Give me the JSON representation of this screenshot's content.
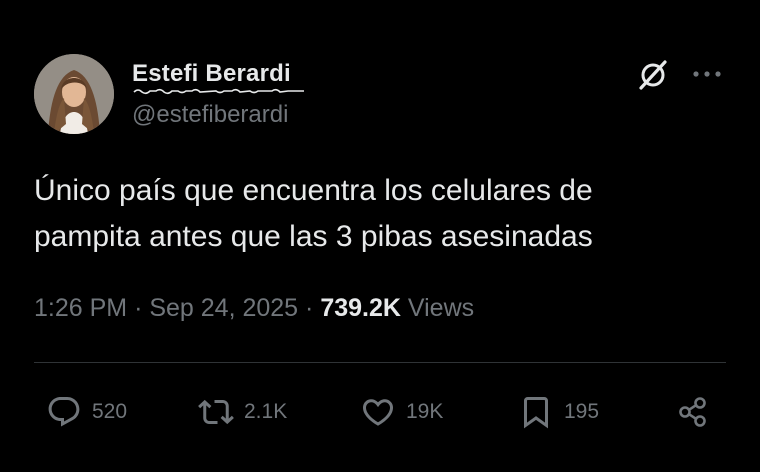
{
  "author": {
    "display_name": "Estefi Berardi",
    "handle": "@estefiberardi"
  },
  "tweet": {
    "text_line1": "Único país que encuentra los celulares de",
    "text_line2": "pampita antes que las 3 pibas asesinadas"
  },
  "meta": {
    "time": "1:26 PM",
    "separator1": "·",
    "date": "Sep 24, 2025",
    "separator2": "·",
    "views_count": "739.2K",
    "views_label": "Views"
  },
  "actions": {
    "replies": "520",
    "reposts": "2.1K",
    "likes": "19K",
    "bookmarks": "195"
  },
  "icons": {
    "header_right": [
      "grok-icon",
      "more-icon"
    ],
    "action_bar": [
      "reply-icon",
      "repost-icon",
      "like-icon",
      "bookmark-icon",
      "share-icon"
    ]
  },
  "colors": {
    "background": "#000000",
    "primary_text": "#e7e9ea",
    "secondary_text": "#71767b",
    "divider": "#2f3336"
  }
}
